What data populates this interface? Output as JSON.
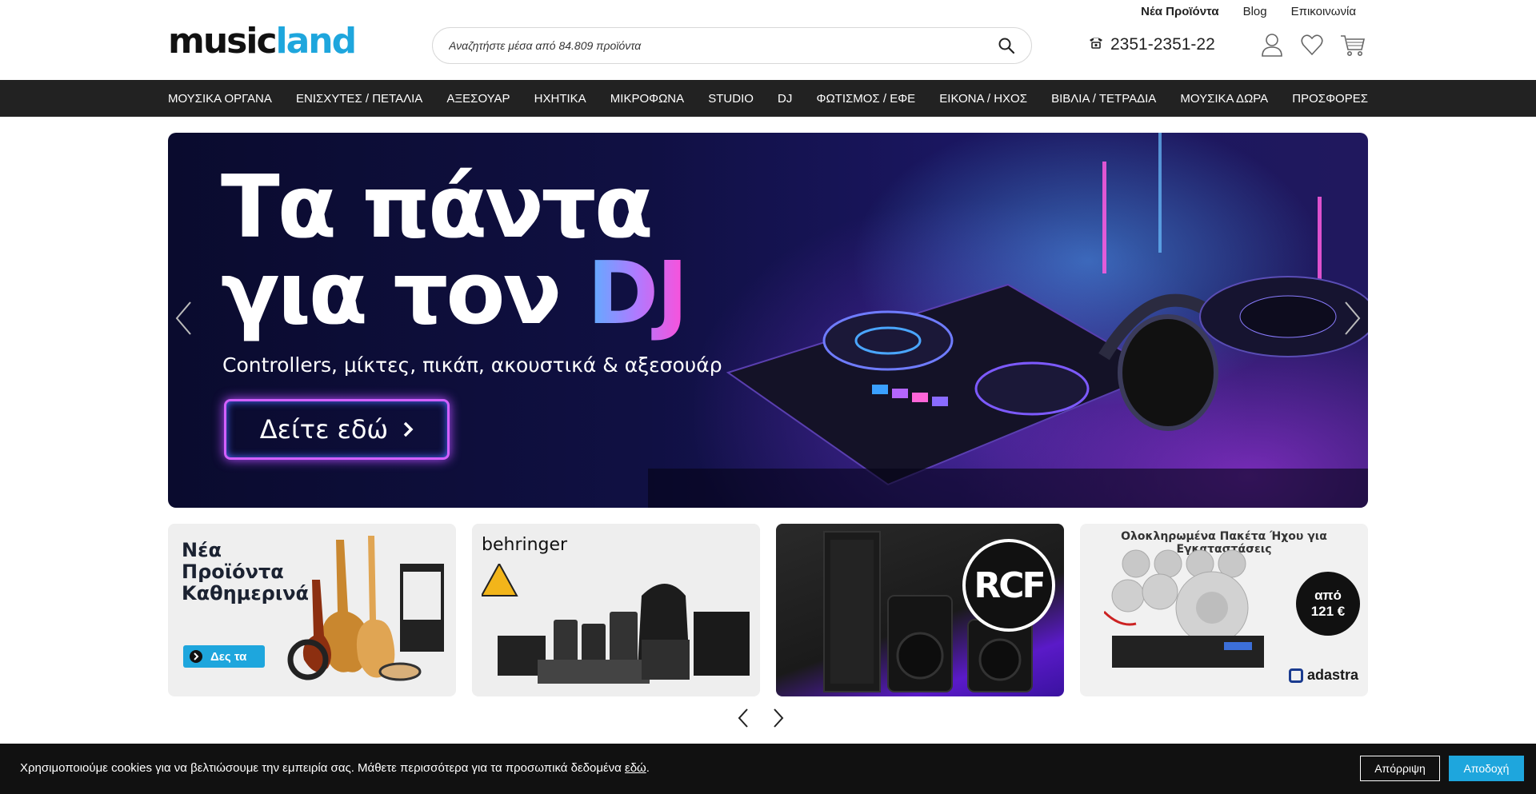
{
  "header": {
    "logo": {
      "part1": "music",
      "part2": "land"
    },
    "top_links": [
      "Νέα Προϊόντα",
      "Blog",
      "Επικοινωνία"
    ],
    "search": {
      "placeholder": "Αναζητήστε μέσα από 84.809 προϊόντα"
    },
    "phone": "2351-2351-22",
    "icons": [
      "phone-icon",
      "user-icon",
      "heart-icon",
      "cart-icon",
      "search-icon"
    ]
  },
  "nav": {
    "items": [
      "ΜΟΥΣΙΚΑ ΟΡΓΑΝΑ",
      "ΕΝΙΣΧΥΤΕΣ / ΠΕΤΑΛΙΑ",
      "ΑΞΕΣΟΥΑΡ",
      "ΗΧΗΤΙΚΑ",
      "ΜΙΚΡΟΦΩΝΑ",
      "STUDIO",
      "DJ",
      "ΦΩΤΙΣΜΟΣ / ΕΦΕ",
      "ΕΙΚΟΝΑ / ΗΧΟΣ",
      "ΒΙΒΛΙΑ / ΤΕΤΡΑΔΙΑ",
      "ΜΟΥΣΙΚΑ ΔΩΡΑ",
      "ΠΡΟΣΦΟΡΕΣ"
    ]
  },
  "hero": {
    "line1": "Τα πάντα",
    "line2": "για τον",
    "highlight": "DJ",
    "subtitle": "Controllers, μίκτες, πικάπ, ακουστικά & αξεσουάρ",
    "cta": "Δείτε εδώ"
  },
  "tiles": {
    "new_products": {
      "line1": "Νέα",
      "line2": "Προϊόντα",
      "line3": "Καθημερινά",
      "button": "Δες τα"
    },
    "behringer": {
      "brand": "behringer"
    },
    "rcf": {
      "brand": "RCF"
    },
    "adastra": {
      "heading": "Ολοκληρωμένα Πακέτα Ήχου για Εγκαταστάσεις",
      "price_prefix": "από",
      "price": "121 €",
      "brand": "adastra"
    }
  },
  "cookie": {
    "message": "Χρησιμοποιούμε cookies για να βελτιώσουμε την εμπειρία σας. Μάθετε περισσότερα για τα προσωπικά δεδομένα",
    "link": "εδώ",
    "suffix": ".",
    "reject": "Απόρριψη",
    "accept": "Αποδοχή"
  },
  "colors": {
    "accent": "#1ea6dd",
    "nav_bg": "#222222",
    "cookie_bg": "#111111"
  }
}
